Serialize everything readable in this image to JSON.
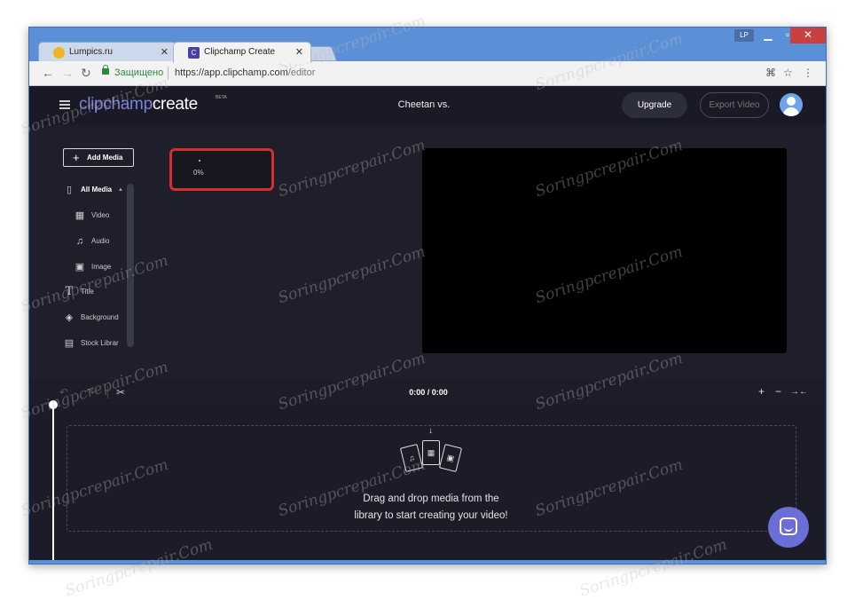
{
  "browser": {
    "tabs": [
      {
        "label": "Lumpics.ru",
        "favicon_color": "#f0b428"
      },
      {
        "label": "Clipchamp Create",
        "favicon_color": "#4a3fa8"
      }
    ],
    "user_badge": "LP",
    "address": {
      "security_label": "Защищено",
      "url_base": "https://app.clipchamp.com",
      "url_path": "/editor"
    }
  },
  "app": {
    "logo_part1": "clipchamp",
    "logo_part2": "create",
    "logo_badge": "BETA",
    "project_title": "Cheetan vs.",
    "upgrade_label": "Upgrade",
    "export_label": "Export Video",
    "accent_color": "#6b6ed6"
  },
  "sidebar": {
    "add_media_label": "Add Media",
    "items": [
      {
        "label": "All Media",
        "icon": "file-icon"
      },
      {
        "label": "Video",
        "icon": "film-icon"
      },
      {
        "label": "Audio",
        "icon": "music-icon"
      },
      {
        "label": "Image",
        "icon": "image-icon"
      },
      {
        "label": "Title",
        "icon": "text-icon"
      },
      {
        "label": "Background",
        "icon": "layers-icon"
      },
      {
        "label": "Stock Librar",
        "icon": "store-icon"
      }
    ]
  },
  "media": {
    "upload_progress": "0%"
  },
  "timeline": {
    "timecode": "0:00 / 0:00",
    "drop_line1": "Drag and drop media from the",
    "drop_line2": "library to start creating your video!"
  },
  "watermark": "Soringpcrepair.Com"
}
